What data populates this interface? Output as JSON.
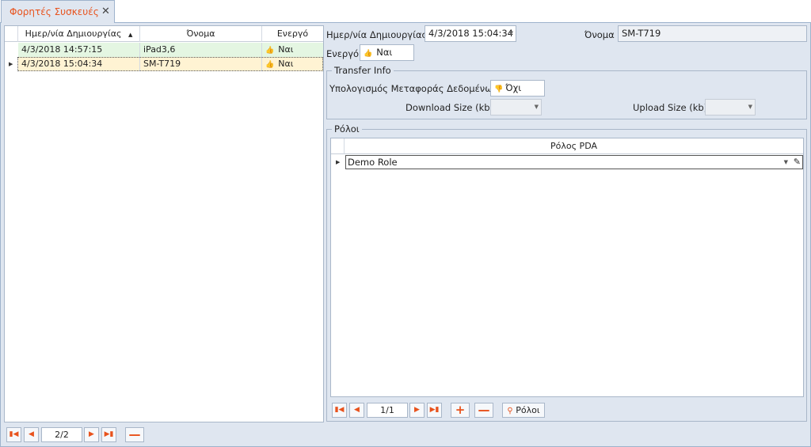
{
  "tab": {
    "label": "Φορητές Συσκευές",
    "close": "✕"
  },
  "grid": {
    "columns": [
      "Ημερ/νία Δημιουργίας",
      "Όνομα",
      "Ενεργό"
    ],
    "sort_indicator": "▲",
    "rows": [
      {
        "date": "4/3/2018 14:57:15",
        "name": "iPad3,6",
        "active": "Ναι"
      },
      {
        "date": "4/3/2018 15:04:34",
        "name": "SM-T719",
        "active": "Ναι"
      }
    ],
    "nav": {
      "page": "2/2"
    }
  },
  "form": {
    "created_label": "Ημερ/νία Δημιουργίας",
    "created_value": "4/3/2018 15:04:34",
    "name_label": "Όνομα",
    "name_value": "SM-T719",
    "active_label": "Ενεργό",
    "active_value": "Ναι",
    "transfer": {
      "title": "Transfer Info",
      "calc_label": "Υπολογισμός Μεταφοράς Δεδομένων",
      "calc_value": "Όχι",
      "download_label": "Download Size (kb)",
      "upload_label": "Upload Size (kb)"
    },
    "roles": {
      "title": "Ρόλοι",
      "column": "Ρόλος PDA",
      "rows": [
        "Demo Role"
      ],
      "nav": {
        "page": "1/1",
        "roles_button": "Ρόλοι"
      }
    }
  },
  "colors": {
    "accent": "#e8521c",
    "panel": "#dfe6f0",
    "row_green": "#e4f6e2",
    "row_yellow": "#fff3d3"
  }
}
